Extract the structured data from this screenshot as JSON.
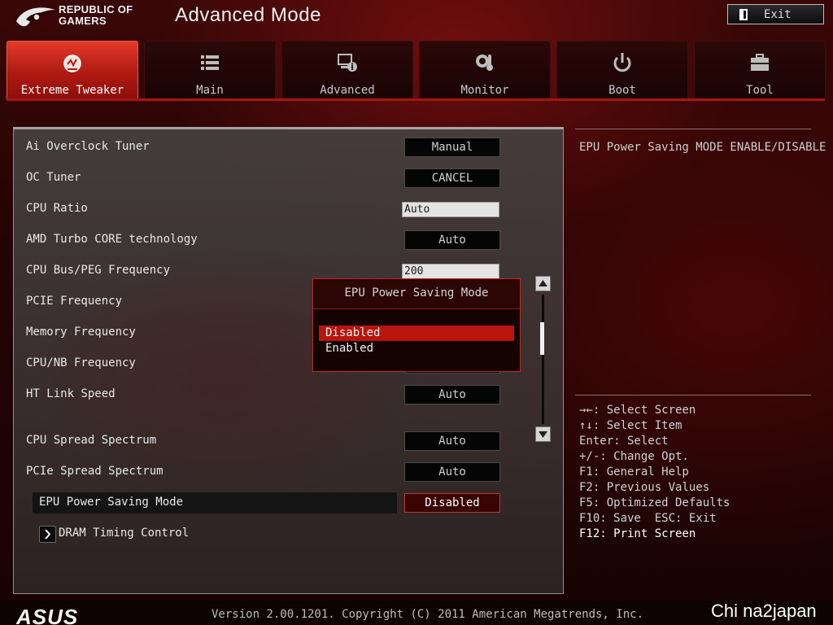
{
  "header": {
    "brand_line1": "REPUBLIC OF",
    "brand_line2": "GAMERS",
    "title": "Advanced Mode",
    "exit_label": "Exit"
  },
  "tabs": [
    {
      "label": "Extreme Tweaker",
      "icon": "extreme-tweaker-icon",
      "active": true
    },
    {
      "label": "Main",
      "icon": "list-icon",
      "active": false
    },
    {
      "label": "Advanced",
      "icon": "advanced-icon",
      "active": false
    },
    {
      "label": "Monitor",
      "icon": "thermometer-icon",
      "active": false
    },
    {
      "label": "Boot",
      "icon": "power-icon",
      "active": false
    },
    {
      "label": "Tool",
      "icon": "toolbox-icon",
      "active": false
    }
  ],
  "settings": [
    {
      "label": "Ai Overclock Tuner",
      "value": "Manual",
      "kind": "button"
    },
    {
      "label": "OC Tuner",
      "value": "CANCEL",
      "kind": "button"
    },
    {
      "label": "CPU Ratio",
      "value": "Auto",
      "kind": "input"
    },
    {
      "label": "AMD Turbo CORE technology",
      "value": "Auto",
      "kind": "button"
    },
    {
      "label": "CPU Bus/PEG Frequency",
      "value": "200",
      "kind": "input"
    },
    {
      "label": "PCIE Frequency",
      "value": "",
      "kind": "hidden"
    },
    {
      "label": "Memory Frequency",
      "value": "",
      "kind": "hidden"
    },
    {
      "label": "CPU/NB Frequency",
      "value": "",
      "kind": "hidden"
    },
    {
      "label": "HT Link Speed",
      "value": "Auto",
      "kind": "button"
    },
    {
      "label": "CPU Spread Spectrum",
      "value": "Auto",
      "kind": "button"
    },
    {
      "label": "PCIe Spread Spectrum",
      "value": "Auto",
      "kind": "button"
    },
    {
      "label": "EPU Power Saving Mode",
      "value": "Disabled",
      "kind": "button",
      "highlighted": true
    },
    {
      "label": "DRAM Timing Control",
      "value": "",
      "kind": "submenu"
    }
  ],
  "popup": {
    "title": "EPU Power Saving Mode",
    "options": [
      "Disabled",
      "Enabled"
    ],
    "selected": "Disabled"
  },
  "help": {
    "description": "EPU Power Saving MODE ENABLE/DISABLE",
    "keys": [
      "→←: Select Screen",
      "↑↓: Select Item",
      "Enter: Select",
      "+/-: Change Opt.",
      "F1: General Help",
      "F2: Previous Values",
      "F5: Optimized Defaults",
      "F10: Save  ESC: Exit",
      "F12: Print Screen"
    ]
  },
  "footer": {
    "logo": "ASUS",
    "version": "Version 2.00.1201. Copyright (C) 2011 American Megatrends, Inc.",
    "watermark": "Chi na2japan"
  },
  "colors": {
    "accent_red": "#b8150d",
    "active_tab": "#e23a2a",
    "background": "#220404"
  }
}
